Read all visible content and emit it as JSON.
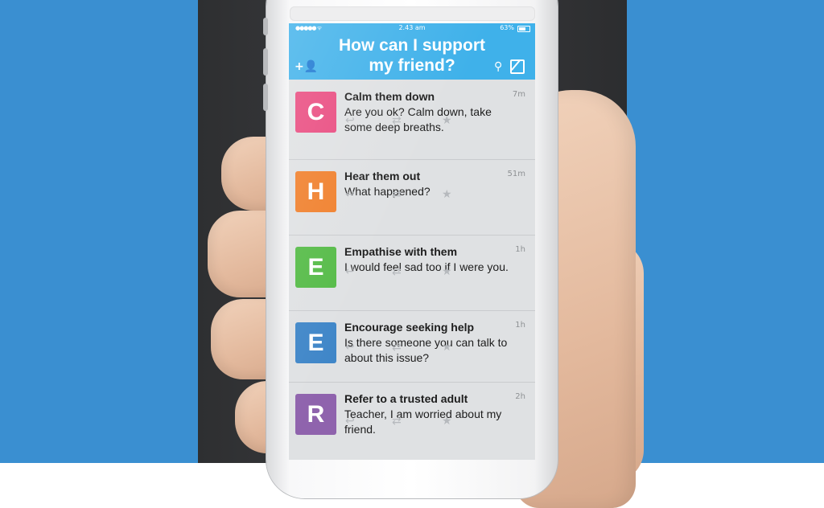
{
  "status_bar": {
    "signal": "●●●●● ᯤ",
    "time": "2.43 am",
    "battery": "63%"
  },
  "header": {
    "title_line1": "How can I support",
    "title_line2": "my friend?"
  },
  "icons": {
    "add_user": "+👤",
    "search": "⚲",
    "reply": "↩",
    "retweet": "⇄",
    "star": "★"
  },
  "messages": [
    {
      "letter": "C",
      "color": "#e94a7f",
      "title": "Calm them down",
      "body": "Are you ok? Calm down, take some deep breaths.",
      "time": "7m"
    },
    {
      "letter": "H",
      "color": "#f07f2b",
      "title": "Hear them out",
      "body": "What happened?",
      "time": "51m"
    },
    {
      "letter": "E",
      "color": "#55bb47",
      "title": "Empathise with them",
      "body": "I would feel sad too if I were you.",
      "time": "1h"
    },
    {
      "letter": "E",
      "color": "#3f86c8",
      "title": "Encourage seeking help",
      "body": "Is there someone you can talk to about this issue?",
      "time": "1h"
    },
    {
      "letter": "R",
      "color": "#8f63ad",
      "title": "Refer to a trusted adult",
      "body": "Teacher, I am worried about my friend.",
      "time": "2h"
    }
  ]
}
